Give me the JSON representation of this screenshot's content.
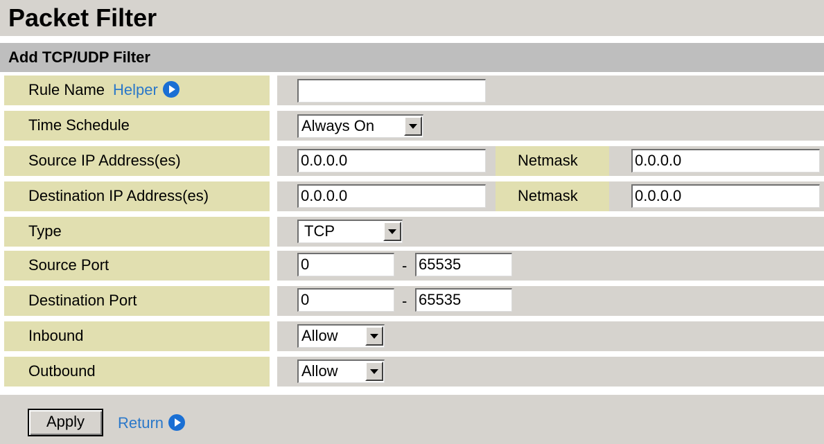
{
  "page": {
    "title": "Packet Filter",
    "section": "Add TCP/UDP Filter"
  },
  "form": {
    "rule_name": {
      "label": "Rule Name",
      "helper": "Helper",
      "value": ""
    },
    "time_schedule": {
      "label": "Time Schedule",
      "selected": "Always On"
    },
    "source_ip": {
      "label": "Source IP Address(es)",
      "value": "0.0.0.0",
      "netmask_label": "Netmask",
      "netmask": "0.0.0.0"
    },
    "dest_ip": {
      "label": "Destination IP Address(es)",
      "value": "0.0.0.0",
      "netmask_label": "Netmask",
      "netmask": "0.0.0.0"
    },
    "type": {
      "label": "Type",
      "selected": "TCP"
    },
    "source_port": {
      "label": "Source Port",
      "from": "0",
      "sep": "-",
      "to": "65535"
    },
    "dest_port": {
      "label": "Destination Port",
      "from": "0",
      "sep": "-",
      "to": "65535"
    },
    "inbound": {
      "label": "Inbound",
      "selected": "Allow"
    },
    "outbound": {
      "label": "Outbound",
      "selected": "Allow"
    }
  },
  "footer": {
    "apply_label": "Apply",
    "return_label": "Return"
  },
  "colors": {
    "label_bg": "#e1dfb0",
    "value_bg": "#d6d3ce",
    "section_bg": "#bebebe",
    "link": "#2b78c9",
    "icon": "#1a6fd4"
  }
}
